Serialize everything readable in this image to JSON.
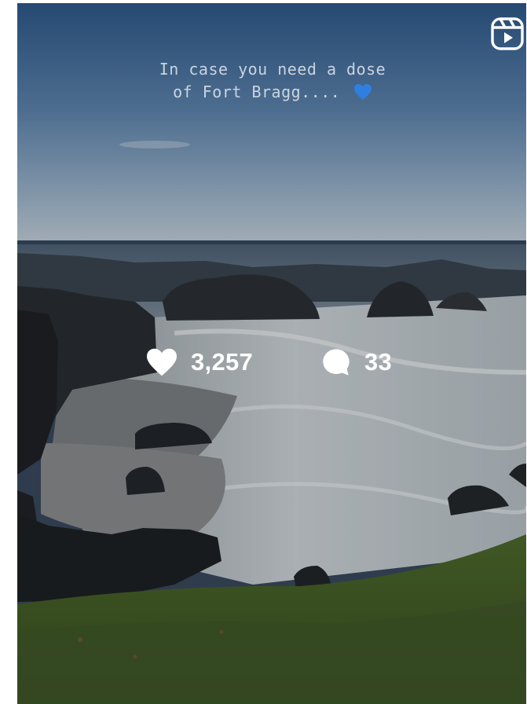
{
  "post": {
    "caption_line1": "In case you need a dose",
    "caption_line2": "of Fort Bragg....",
    "caption_emoji": "blue-heart-icon",
    "media_type_icon": "reels-icon",
    "likes_icon": "heart-icon",
    "likes_count": "3,257",
    "comments_icon": "comment-icon",
    "comments_count": "33"
  },
  "colors": {
    "overlay_text": "#ffffff",
    "caption_text": "#e1e8f0",
    "emoji_blue": "#2f7fe0"
  }
}
